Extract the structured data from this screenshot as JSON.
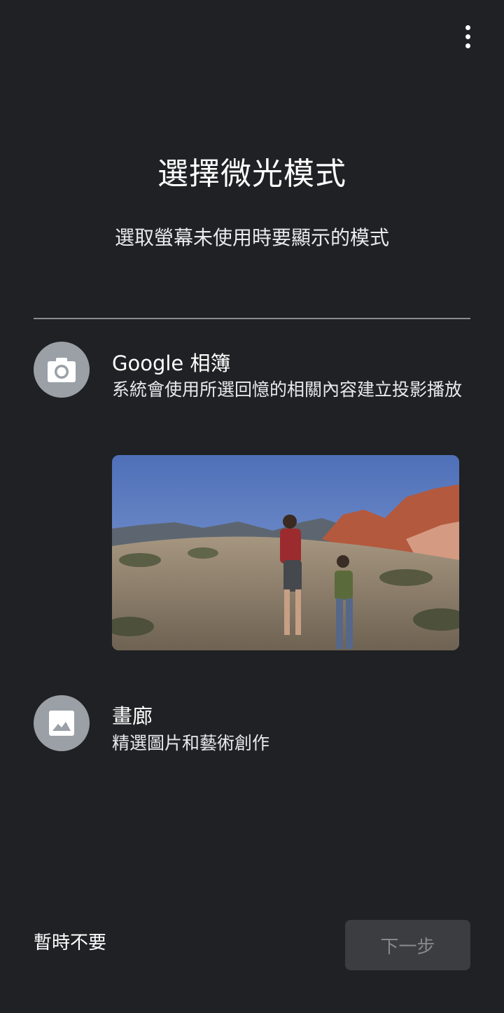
{
  "header": {
    "menu_icon": "more-vert-icon"
  },
  "title": "選擇微光模式",
  "subtitle": "選取螢幕未使用時要顯示的模式",
  "options": [
    {
      "icon": "camera-icon",
      "title": "Google 相簿",
      "description": "系統會使用所選回憶的相關內容建立投影播放",
      "has_preview": true
    },
    {
      "icon": "image-icon",
      "title": "畫廊",
      "description": "精選圖片和藝術創作",
      "has_preview": false
    }
  ],
  "footer": {
    "skip_label": "暫時不要",
    "next_label": "下一步",
    "next_enabled": false
  },
  "colors": {
    "background": "#202124",
    "icon_circle": "#9aa0a6",
    "button_disabled_bg": "#3c3d40",
    "button_disabled_text": "#86888c"
  }
}
